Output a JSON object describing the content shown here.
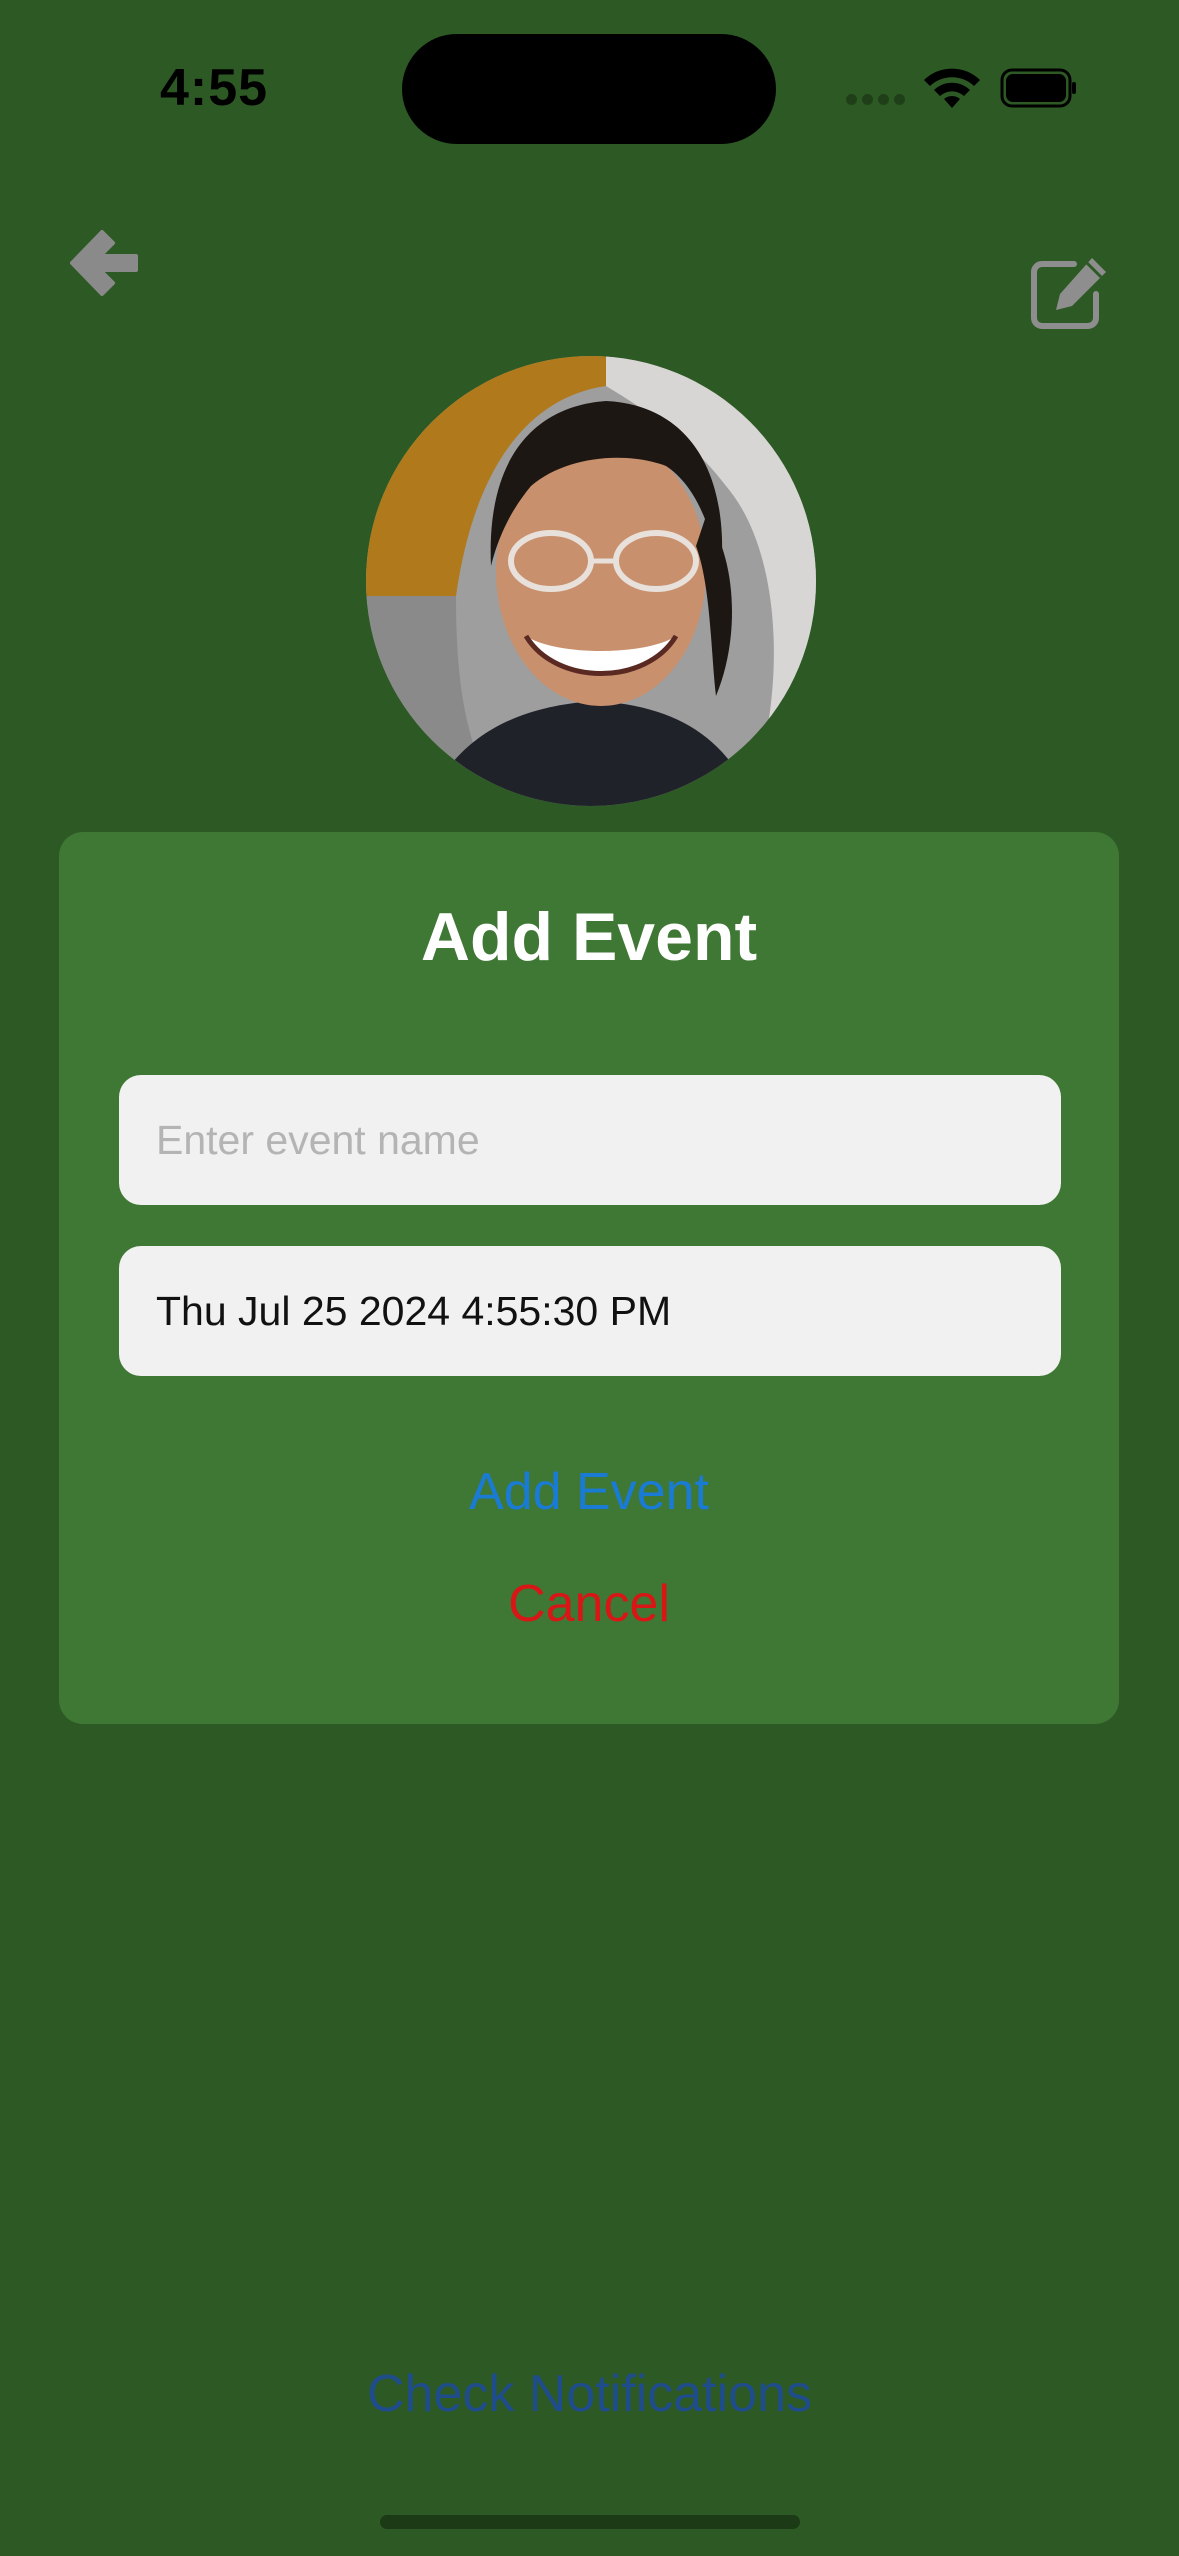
{
  "status_bar": {
    "time": "4:55"
  },
  "header": {
    "back_icon": "arrow-left-icon",
    "edit_icon": "edit-square-icon"
  },
  "profile": {
    "avatar": "profile-photo"
  },
  "modal": {
    "title": "Add Event",
    "event_name_placeholder": "Enter event name",
    "event_name_value": "",
    "date_value": "Thu Jul 25 2024 4:55:30 PM",
    "add_label": "Add Event",
    "cancel_label": "Cancel"
  },
  "footer": {
    "check_notifications_label": "Check Notifications"
  },
  "colors": {
    "background": "#2d5a24",
    "modal": "#3f7734",
    "accent_link": "#1a7bd4",
    "cancel": "#d91616",
    "muted_link": "#1f4c8a"
  }
}
